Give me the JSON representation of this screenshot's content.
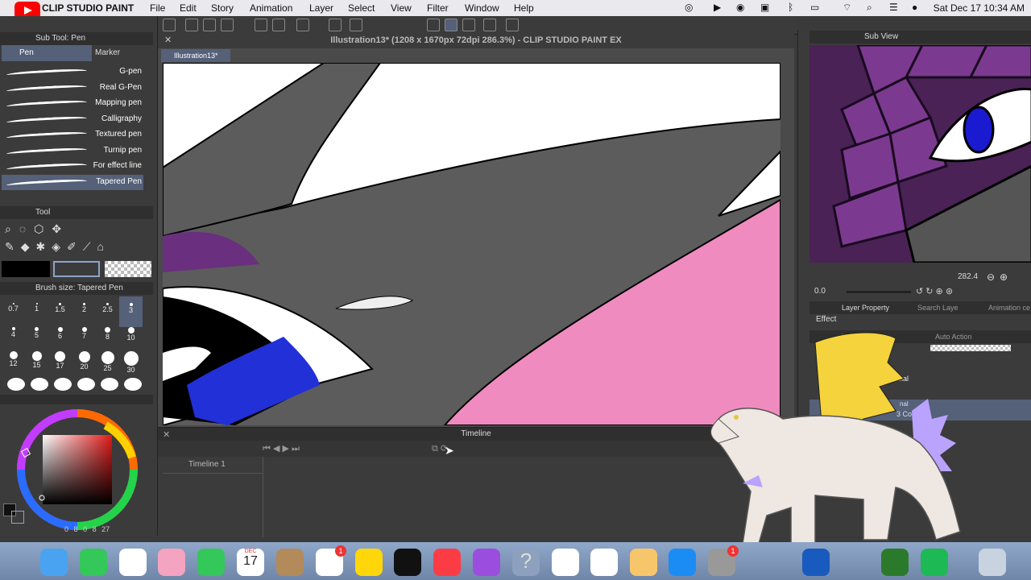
{
  "menubar": {
    "app_name": "CLIP STUDIO PAINT",
    "items": [
      "File",
      "Edit",
      "Story",
      "Animation",
      "Layer",
      "Select",
      "View",
      "Filter",
      "Window",
      "Help"
    ],
    "clock": "Sat Dec 17  10:34 AM"
  },
  "window": {
    "title": "Illustration13* (1208 x 1670px 72dpi 286.3%)  - CLIP STUDIO PAINT EX",
    "doc_tab": "Illustration13*"
  },
  "subtool": {
    "header": "Sub Tool: Pen",
    "tabs": [
      "Pen",
      "Marker"
    ],
    "brushes": [
      "G-pen",
      "Real G-Pen",
      "Mapping pen",
      "Calligraphy",
      "Textured pen",
      "Turnip pen",
      "For effect line",
      "Tapered Pen"
    ],
    "active_brush": "Tapered Pen"
  },
  "tool_panel": {
    "header": "Tool"
  },
  "brush_size": {
    "header": "Brush size: Tapered Pen",
    "values": [
      "0.7",
      "1",
      "1.5",
      "2",
      "2.5",
      "3",
      "4",
      "5",
      "6",
      "7",
      "8",
      "10",
      "12",
      "15",
      "17",
      "20",
      "25",
      "30"
    ],
    "active": "3"
  },
  "color_footer": [
    "0",
    "8",
    "0",
    "8",
    "27"
  ],
  "timeline": {
    "header": "Timeline",
    "track": "Timeline 1"
  },
  "subview": {
    "header": "Sub View",
    "zoom": "282.4",
    "angle": "0.0"
  },
  "layer_property": {
    "tabs": [
      "Layer Property",
      "Search Laye",
      "Animation ce"
    ],
    "effect": "Effect",
    "layer_tab": "Laye",
    "auto_action": "Auto Action",
    "blend": "Normal",
    "layers": [
      "nal",
      "3 Copy"
    ]
  },
  "dock": {
    "calendar_month": "DEC",
    "calendar_day": "17",
    "badges": [
      "1",
      "1"
    ]
  },
  "colors": {
    "canvas_gray": "#5c5c5c",
    "pink": "#f08bbf",
    "purple": "#6a2f7e",
    "eye_blue": "#2230d8",
    "accent": "#556079"
  }
}
